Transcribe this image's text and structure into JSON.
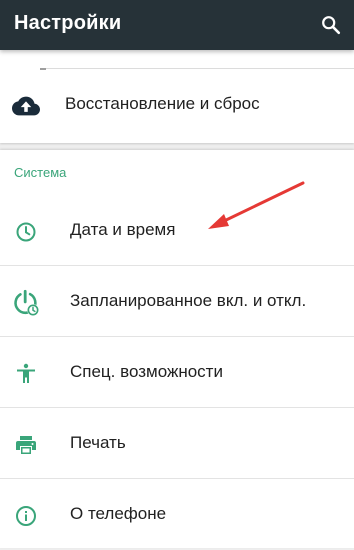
{
  "appbar": {
    "title": "Настройки",
    "search_icon": "search-icon"
  },
  "backup": {
    "label": "Восстановление и сброс",
    "icon": "cloud-upload-icon"
  },
  "system": {
    "section_title": "Система",
    "items": [
      {
        "label": "Дата и время",
        "icon": "clock-icon"
      },
      {
        "label": "Запланированное вкл. и откл.",
        "icon": "power-schedule-icon"
      },
      {
        "label": "Спец. возможности",
        "icon": "accessibility-icon"
      },
      {
        "label": "Печать",
        "icon": "print-icon"
      },
      {
        "label": "О телефоне",
        "icon": "info-icon"
      }
    ]
  },
  "colors": {
    "appbar": "#263238",
    "accent": "#3aa57a",
    "arrow": "#e53935",
    "cloud": "#1a2b3a"
  }
}
